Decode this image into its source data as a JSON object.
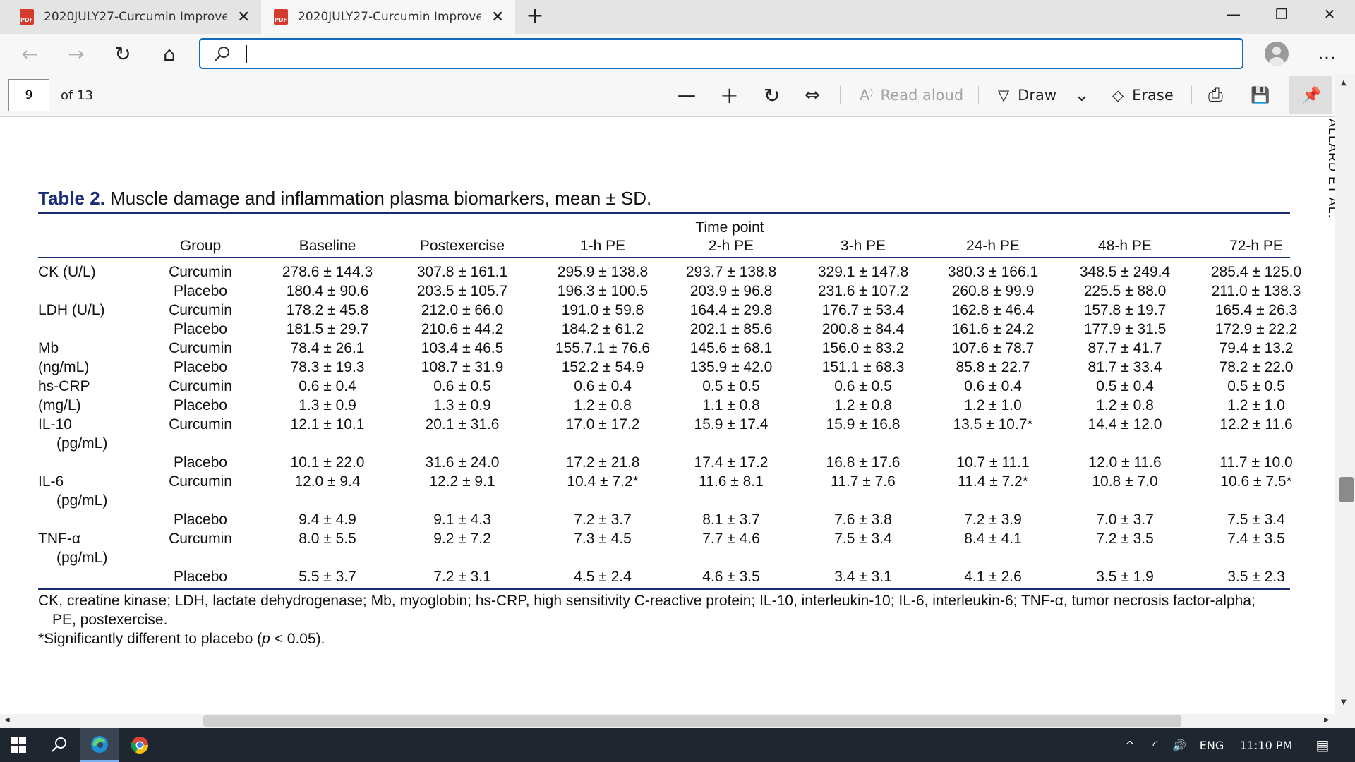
{
  "tabs": [
    {
      "title": "2020JULY27-Curcumin Improves",
      "icon": "pdf-icon",
      "active": false
    },
    {
      "title": "2020JULY27-Curcumin Improves",
      "icon": "pdf-icon",
      "active": true
    }
  ],
  "icons": {
    "pdf_badge": "PDF",
    "new_tab": "+",
    "close": "✕",
    "minimize": "—",
    "restore": "❐",
    "back": "←",
    "forward": "→",
    "refresh": "↻",
    "home": "⌂",
    "more": "…",
    "zoom_out": "—",
    "zoom_in": "+",
    "rotate": "↻",
    "fit": "⇔",
    "read_aloud": "A⁾",
    "draw": "▽",
    "chevron_down": "⌄",
    "erase": "◇",
    "print": "⎙",
    "save": "💾",
    "pin": "📌",
    "scroll_up": "▲",
    "scroll_down": "▼",
    "scroll_left": "◀",
    "scroll_right": "▶",
    "search": "⌕",
    "chevron_up": "^",
    "network": "◜",
    "volume": "🔊",
    "notification": "▤"
  },
  "address_bar": {
    "value": "",
    "placeholder": ""
  },
  "pdf_toolbar": {
    "page_number": "9",
    "page_total": "of 13",
    "read_aloud": "Read aloud",
    "draw": "Draw",
    "erase": "Erase"
  },
  "document": {
    "running_head": "ALLARD ET AL.",
    "caption_label": "Table 2.",
    "caption_text": "Muscle damage and inflammation plasma biomarkers, mean ± SD.",
    "header_spanner": "Time point",
    "columns": [
      "Group",
      "Baseline",
      "Postexercise",
      "1-h PE",
      "2-h PE",
      "3-h PE",
      "24-h PE",
      "48-h PE",
      "72-h PE"
    ],
    "rows": [
      {
        "label": "CK (U/L)",
        "group": "Curcumin",
        "values": [
          "278.6 ± 144.3",
          "307.8 ± 161.1",
          "295.9 ± 138.8",
          "293.7 ± 138.8",
          "329.1 ± 147.8",
          "380.3 ± 166.1",
          "348.5 ± 249.4",
          "285.4 ± 125.0"
        ]
      },
      {
        "label": "",
        "group": "Placebo",
        "values": [
          "180.4 ± 90.6",
          "203.5 ± 105.7",
          "196.3 ± 100.5",
          "203.9 ± 96.8",
          "231.6 ± 107.2",
          "260.8 ± 99.9",
          "225.5 ± 88.0",
          "211.0 ± 138.3"
        ]
      },
      {
        "label": "LDH (U/L)",
        "group": "Curcumin",
        "values": [
          "178.2 ± 45.8",
          "212.0 ± 66.0",
          "191.0 ± 59.8",
          "164.4 ± 29.8",
          "176.7 ± 53.4",
          "162.8 ± 46.4",
          "157.8 ± 19.7",
          "165.4 ± 26.3"
        ]
      },
      {
        "label": "",
        "group": "Placebo",
        "values": [
          "181.5 ± 29.7",
          "210.6 ± 44.2",
          "184.2 ± 61.2",
          "202.1 ± 85.6",
          "200.8 ± 84.4",
          "161.6 ± 24.2",
          "177.9 ± 31.5",
          "172.9 ± 22.2"
        ]
      },
      {
        "label": "Mb",
        "group": "Curcumin",
        "values": [
          "78.4 ± 26.1",
          "103.4 ± 46.5",
          "155.7.1 ± 76.6",
          "145.6 ± 68.1",
          "156.0 ± 83.2",
          "107.6 ± 78.7",
          "87.7 ± 41.7",
          "79.4 ± 13.2"
        ]
      },
      {
        "label": "(ng/mL)",
        "group": "Placebo",
        "values": [
          "78.3 ± 19.3",
          "108.7 ± 31.9",
          "152.2 ± 54.9",
          "135.9 ± 42.0",
          "151.1 ± 68.3",
          "85.8 ± 22.7",
          "81.7 ± 33.4",
          "78.2 ± 22.0"
        ]
      },
      {
        "label": "hs-CRP",
        "group": "Curcumin",
        "values": [
          "0.6 ± 0.4",
          "0.6 ± 0.5",
          "0.6 ± 0.4",
          "0.5 ± 0.5",
          "0.6 ± 0.5",
          "0.6 ± 0.4",
          "0.5 ± 0.4",
          "0.5 ± 0.5"
        ]
      },
      {
        "label": "(mg/L)",
        "group": "Placebo",
        "values": [
          "1.3 ± 0.9",
          "1.3 ± 0.9",
          "1.2 ± 0.8",
          "1.1 ± 0.8",
          "1.2 ± 0.8",
          "1.2 ± 1.0",
          "1.2 ± 0.8",
          "1.2 ± 1.0"
        ]
      },
      {
        "label": "IL-10",
        "group": "Curcumin",
        "values": [
          "12.1 ± 10.1",
          "20.1 ± 31.6",
          "17.0 ± 17.2",
          "15.9 ± 17.4",
          "15.9 ± 16.8",
          "13.5 ± 10.7*",
          "14.4 ± 12.0",
          "12.2 ± 11.6"
        ]
      },
      {
        "label": "(pg/mL)",
        "group": "",
        "values": [
          "",
          "",
          "",
          "",
          "",
          "",
          "",
          ""
        ]
      },
      {
        "label": "",
        "group": "Placebo",
        "values": [
          "10.1 ± 22.0",
          "31.6 ± 24.0",
          "17.2 ± 21.8",
          "17.4 ± 17.2",
          "16.8 ± 17.6",
          "10.7 ± 11.1",
          "12.0 ± 11.6",
          "11.7 ± 10.0"
        ]
      },
      {
        "label": "IL-6",
        "group": "Curcumin",
        "values": [
          "12.0 ± 9.4",
          "12.2 ± 9.1",
          "10.4 ± 7.2*",
          "11.6 ± 8.1",
          "11.7 ± 7.6",
          "11.4 ± 7.2*",
          "10.8 ± 7.0",
          "10.6 ± 7.5*"
        ]
      },
      {
        "label": "(pg/mL)",
        "group": "",
        "values": [
          "",
          "",
          "",
          "",
          "",
          "",
          "",
          ""
        ]
      },
      {
        "label": "",
        "group": "Placebo",
        "values": [
          "9.4 ± 4.9",
          "9.1 ± 4.3",
          "7.2 ± 3.7",
          "8.1 ± 3.7",
          "7.6 ± 3.8",
          "7.2 ± 3.9",
          "7.0 ± 3.7",
          "7.5 ± 3.4"
        ]
      },
      {
        "label": "TNF-α",
        "group": "Curcumin",
        "values": [
          "8.0 ± 5.5",
          "9.2 ± 7.2",
          "7.3 ± 4.5",
          "7.7 ± 4.6",
          "7.5 ± 3.4",
          "8.4 ± 4.1",
          "7.2 ± 3.5",
          "7.4 ± 3.5"
        ]
      },
      {
        "label": "(pg/mL)",
        "group": "",
        "values": [
          "",
          "",
          "",
          "",
          "",
          "",
          "",
          ""
        ]
      },
      {
        "label": "",
        "group": "Placebo",
        "values": [
          "5.5 ± 3.7",
          "7.2 ± 3.1",
          "4.5 ± 2.4",
          "4.6 ± 3.5",
          "3.4 ± 3.1",
          "4.1 ± 2.6",
          "3.5 ± 1.9",
          "3.5 ± 2.3"
        ]
      }
    ],
    "footnote_1": "CK, creatine kinase; LDH, lactate dehydrogenase; Mb, myoglobin; hs-CRP, high sensitivity C-reactive protein; IL-10, interleukin-10; IL-6, interleukin-6; TNF-α, tumor necrosis factor-alpha;",
    "footnote_1b": "PE, postexercise.",
    "footnote_2a": "*Significantly different to placebo (",
    "footnote_2b": "p",
    "footnote_2c": " < 0.05)."
  },
  "taskbar": {
    "language": "ENG",
    "time": "11:10 PM"
  },
  "colors": {
    "accent_blue": "#0f6cbd",
    "caption_navy": "#1a2c78",
    "pdf_red": "#d33b2c",
    "taskbar": "#1f2630"
  }
}
